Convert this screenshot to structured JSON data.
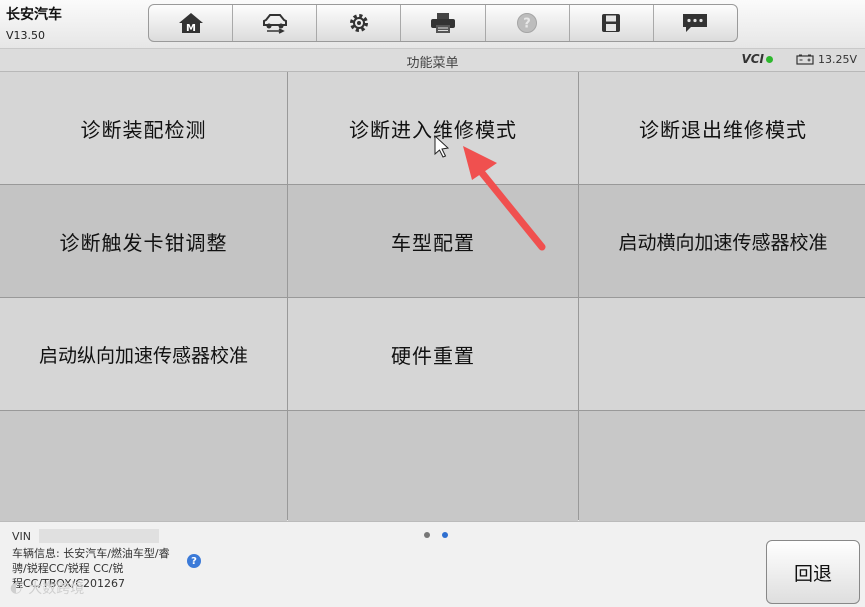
{
  "app": {
    "brand": "长安汽车",
    "version": "V13.50"
  },
  "toolbar": {
    "icons": [
      "home-m-icon",
      "vehicle-swap-icon",
      "gear-icon",
      "printer-icon",
      "help-icon",
      "save-icon",
      "message-icon"
    ]
  },
  "subheader": {
    "title": "功能菜单",
    "vci_label": "VCI",
    "battery_voltage": "13.25V"
  },
  "menu": {
    "items": [
      {
        "label": "诊断装配检测"
      },
      {
        "label": "诊断进入维修模式"
      },
      {
        "label": "诊断退出维修模式"
      },
      {
        "label": "诊断触发卡钳调整"
      },
      {
        "label": "车型配置"
      },
      {
        "label": "启动横向加速传感器校准"
      },
      {
        "label": "启动纵向加速传感器校准"
      },
      {
        "label": "硬件重置"
      },
      {
        "label": ""
      },
      {
        "label": ""
      },
      {
        "label": ""
      },
      {
        "label": ""
      }
    ]
  },
  "footer": {
    "vin_label": "VIN",
    "vehicle_info": "车辆信息: 长安汽车/燃油车型/睿骋/锐程CC/锐程 CC/锐",
    "vehicle_info_tail": "程CC/TBOX/C201267",
    "help_symbol": "?",
    "pager_current": 2,
    "pager_total": 2,
    "back_label": "回退",
    "watermark": "大数跨境"
  },
  "colors": {
    "accent_blue": "#2f6fd0",
    "annotation_arrow": "#f0504f",
    "vci_green": "#2eb82e"
  }
}
